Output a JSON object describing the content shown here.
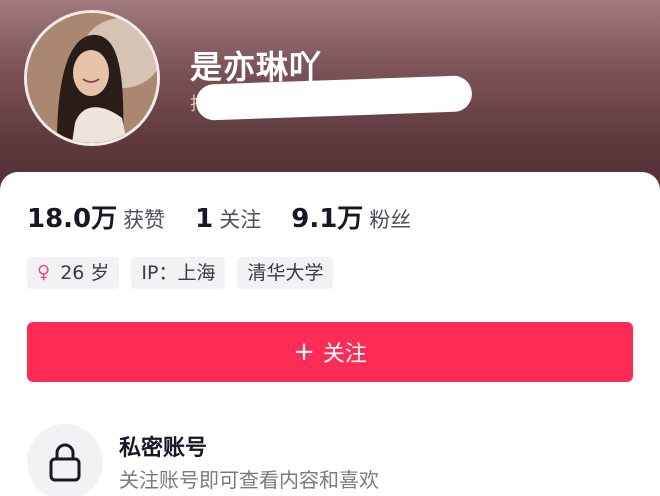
{
  "profile": {
    "nickname": "是亦琳吖",
    "id_prefix": "抖"
  },
  "stats": [
    {
      "value": "18.0万",
      "label": "获赞"
    },
    {
      "value": "1",
      "label": "关注"
    },
    {
      "value": "9.1万",
      "label": "粉丝"
    }
  ],
  "tags": {
    "gender_icon": "♀",
    "age": "26 岁",
    "ip": "IP：上海",
    "school": "清华大学"
  },
  "follow_button": {
    "plus": "+",
    "label": "关注"
  },
  "private_account": {
    "title": "私密账号",
    "description": "关注账号即可查看内容和喜欢"
  },
  "colors": {
    "accent": "#fe2c55",
    "female": "#f0477c",
    "header": "#5e3a3e"
  }
}
